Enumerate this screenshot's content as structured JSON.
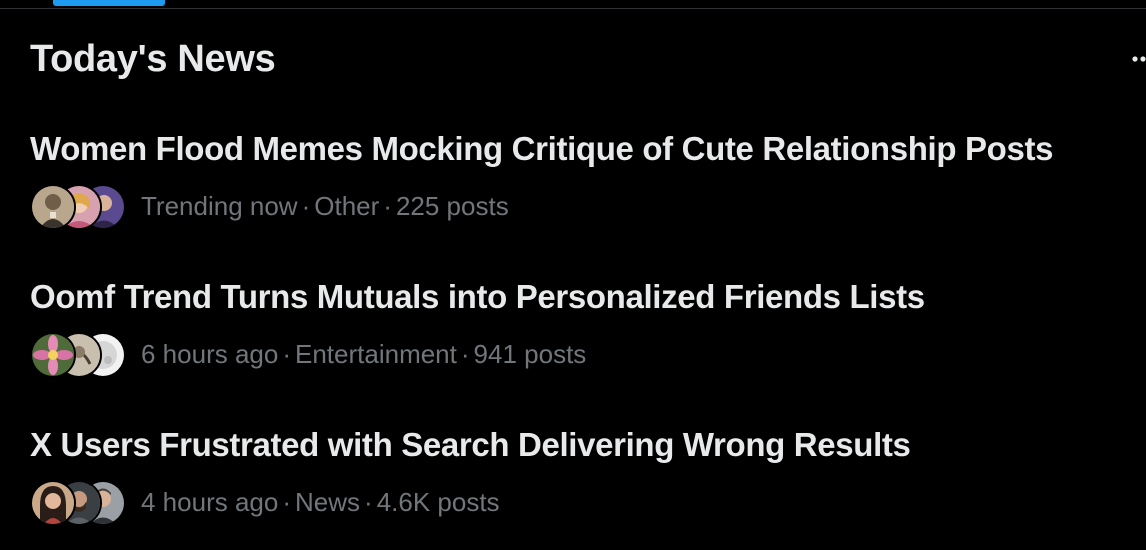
{
  "section": {
    "title": "Today's News",
    "more_icon": "more-horizontal-icon"
  },
  "colors": {
    "background": "#000000",
    "headline": "#e7e9ea",
    "meta": "#71767b",
    "accent": "#1d9bf0",
    "divider": "#2f3336"
  },
  "news": [
    {
      "headline": "Women Flood Memes Mocking Critique of Cute Relationship Posts",
      "time": "Trending now",
      "category": "Other",
      "posts": "225 posts",
      "avatars": [
        "avatar-portrait-vintage",
        "avatar-person-pink",
        "avatar-person-purple"
      ]
    },
    {
      "headline": "Oomf Trend Turns Mutuals into Personalized Friends Lists",
      "time": "6 hours ago",
      "category": "Entertainment",
      "posts": "941 posts",
      "avatars": [
        "avatar-flower",
        "avatar-sketch",
        "avatar-moon"
      ]
    },
    {
      "headline": "X Users Frustrated with Search Delivering Wrong Results",
      "time": "4 hours ago",
      "category": "News",
      "posts": "4.6K posts",
      "avatars": [
        "avatar-person-dark-hair",
        "avatar-person-bearded",
        "avatar-person-man"
      ]
    }
  ],
  "separator": "·"
}
